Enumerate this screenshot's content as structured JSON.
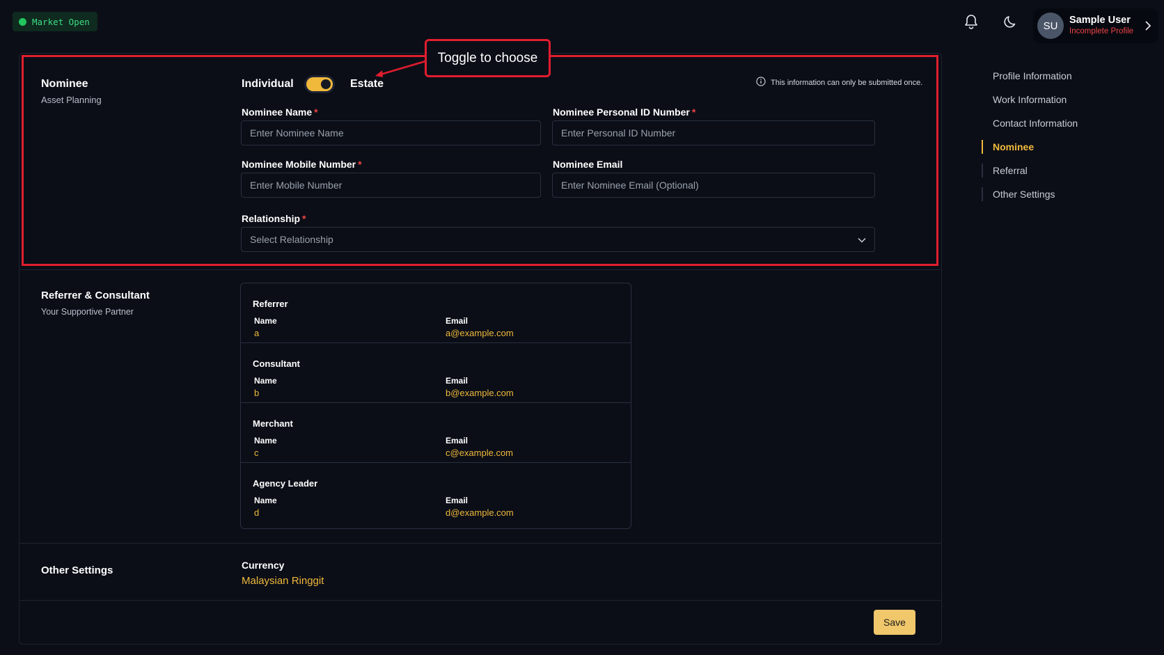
{
  "topbar": {
    "market_status": "Market Open",
    "icons": [
      "bell-icon",
      "moon-icon",
      "chevron-right-icon"
    ],
    "user": {
      "initials": "SU",
      "name": "Sample User",
      "status": "Incomplete Profile"
    }
  },
  "annotation": {
    "callout": "Toggle to choose"
  },
  "nominee": {
    "title": "Nominee",
    "subtitle": "Asset Planning",
    "toggle": {
      "left_label": "Individual",
      "right_label": "Estate",
      "state": "on"
    },
    "info_note": "This information can only be submitted once.",
    "fields": {
      "name": {
        "label": "Nominee Name",
        "placeholder": "Enter Nominee Name"
      },
      "personal_id": {
        "label": "Nominee Personal ID Number",
        "placeholder": "Enter Personal ID Number"
      },
      "mobile": {
        "label": "Nominee Mobile Number",
        "placeholder": "Enter Mobile Number"
      },
      "email": {
        "label": "Nominee Email",
        "placeholder": "Enter Nominee Email (Optional)"
      },
      "relationship": {
        "label": "Relationship",
        "placeholder": "Select Relationship"
      }
    }
  },
  "referrer": {
    "title": "Referrer & Consultant",
    "subtitle": "Your Supportive Partner",
    "name_header": "Name",
    "email_header": "Email",
    "rows": [
      {
        "role": "Referrer",
        "name": "a",
        "email": "a@example.com"
      },
      {
        "role": "Consultant",
        "name": "b",
        "email": "b@example.com"
      },
      {
        "role": "Merchant",
        "name": "c",
        "email": "c@example.com"
      },
      {
        "role": "Agency Leader",
        "name": "d",
        "email": "d@example.com"
      }
    ]
  },
  "other_settings": {
    "title": "Other Settings",
    "currency_label": "Currency",
    "currency_value": "Malaysian Ringgit"
  },
  "actions": {
    "save_label": "Save"
  },
  "right_nav": {
    "items": [
      "Profile Information",
      "Work Information",
      "Contact Information",
      "Nominee",
      "Referral",
      "Other Settings"
    ],
    "active": "Nominee"
  },
  "colors": {
    "accent": "#f0b93b",
    "danger": "#e11d2e",
    "market_green": "#22c55e"
  }
}
